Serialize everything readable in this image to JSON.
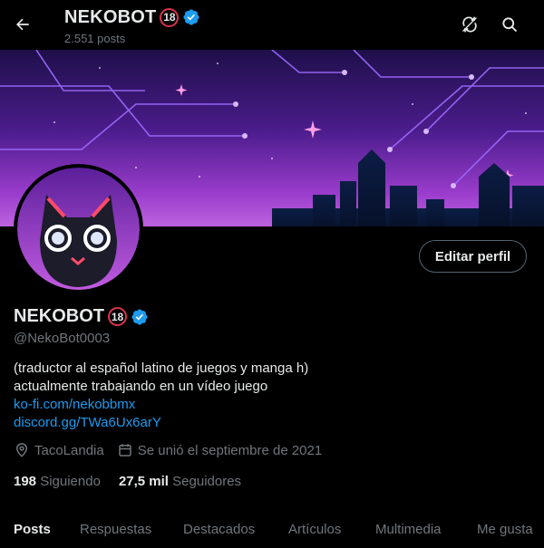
{
  "header": {
    "title": "NEKOBOT",
    "badge": "18",
    "posts_count": "2.551 posts",
    "back_icon": "arrow-left-icon",
    "refresh_icon": "refresh-icon",
    "search_icon": "search-icon"
  },
  "profile": {
    "name": "NEKOBOT",
    "badge": "18",
    "handle": "@NekoBot0003",
    "edit_button": "Editar perfil",
    "bio_line1": "(traductor al español latino de juegos y manga h)",
    "bio_line2": "actualmente trabajando en un vídeo juego",
    "link1": "ko-fi.com/nekobbmx",
    "link2": "discord.gg/TWa6Ux6arY",
    "location": "TacoLandia",
    "joined": "Se unió el septiembre de 2021",
    "following_count": "198",
    "following_label": "Siguiendo",
    "followers_count": "27,5 mil",
    "followers_label": "Seguidores"
  },
  "tabs": [
    {
      "label": "Posts",
      "active": true
    },
    {
      "label": "Respuestas",
      "active": false
    },
    {
      "label": "Destacados",
      "active": false
    },
    {
      "label": "Artículos",
      "active": false
    },
    {
      "label": "Multimedia",
      "active": false
    },
    {
      "label": "Me gusta",
      "active": false
    }
  ],
  "colors": {
    "accent": "#1d9bf0",
    "background": "#000000",
    "muted": "#71767b",
    "text": "#e7e9ea"
  }
}
